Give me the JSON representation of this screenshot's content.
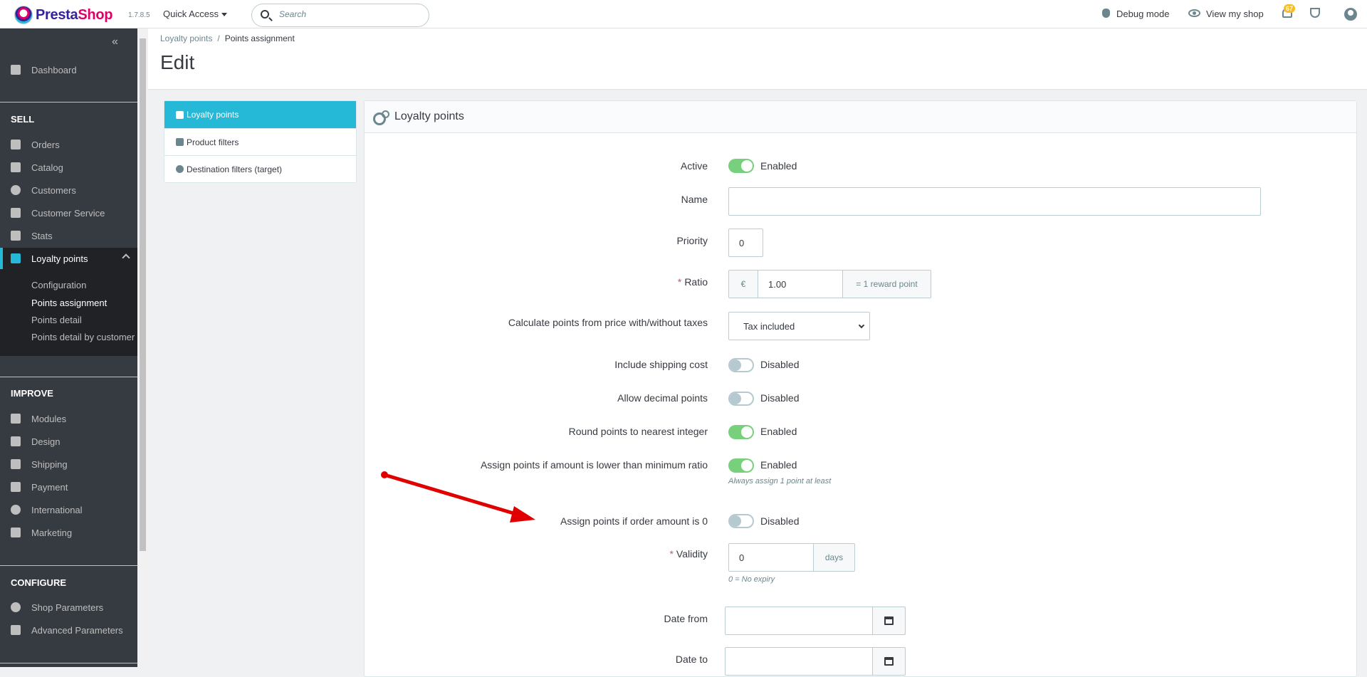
{
  "header": {
    "logo_text_1": "Presta",
    "logo_text_2": "Shop",
    "version": "1.7.8.5",
    "quick_access": "Quick Access",
    "search_placeholder": "Search",
    "debug_mode": "Debug mode",
    "view_shop": "View my shop",
    "notification_count": "67"
  },
  "sidebar": {
    "dashboard": "Dashboard",
    "sell_title": "SELL",
    "sell": [
      "Orders",
      "Catalog",
      "Customers",
      "Customer Service",
      "Stats",
      "Loyalty points"
    ],
    "loyalty_sub": [
      "Configuration",
      "Points assignment",
      "Points detail",
      "Points detail by customer"
    ],
    "improve_title": "IMPROVE",
    "improve": [
      "Modules",
      "Design",
      "Shipping",
      "Payment",
      "International",
      "Marketing"
    ],
    "configure_title": "CONFIGURE",
    "configure": [
      "Shop Parameters",
      "Advanced Parameters"
    ]
  },
  "breadcrumb": {
    "parent": "Loyalty points",
    "separator": "/",
    "current": "Points assignment"
  },
  "page_title": "Edit",
  "tabs": [
    "Loyalty points",
    "Product filters",
    "Destination filters (target)"
  ],
  "panel": {
    "title": "Loyalty points",
    "fields": {
      "active": {
        "label": "Active",
        "state": "Enabled"
      },
      "name": {
        "label": "Name",
        "value": ""
      },
      "priority": {
        "label": "Priority",
        "value": "0"
      },
      "ratio": {
        "label": "Ratio",
        "required": "*",
        "currency": "€",
        "value": "1.00",
        "suffix": "= 1 reward point"
      },
      "calc": {
        "label": "Calculate points from price with/without taxes",
        "value": "Tax included"
      },
      "shipping": {
        "label": "Include shipping cost",
        "state": "Disabled"
      },
      "decimal": {
        "label": "Allow decimal points",
        "state": "Disabled"
      },
      "round": {
        "label": "Round points to nearest integer",
        "state": "Enabled"
      },
      "lower": {
        "label": "Assign points if amount is lower than minimum ratio",
        "state": "Enabled",
        "help": "Always assign 1 point at least"
      },
      "zero": {
        "label": "Assign points if order amount is 0",
        "state": "Disabled"
      },
      "validity": {
        "label": "Validity",
        "required": "*",
        "value": "0",
        "suffix": "days",
        "help": "0 = No expiry"
      },
      "date_from": {
        "label": "Date from",
        "value": ""
      },
      "date_to": {
        "label": "Date to",
        "value": ""
      }
    }
  },
  "colors": {
    "accent": "#25b9d7",
    "switch_on": "#78d07d",
    "sidebar_bg": "#363a41",
    "arrow": "#e00000"
  }
}
